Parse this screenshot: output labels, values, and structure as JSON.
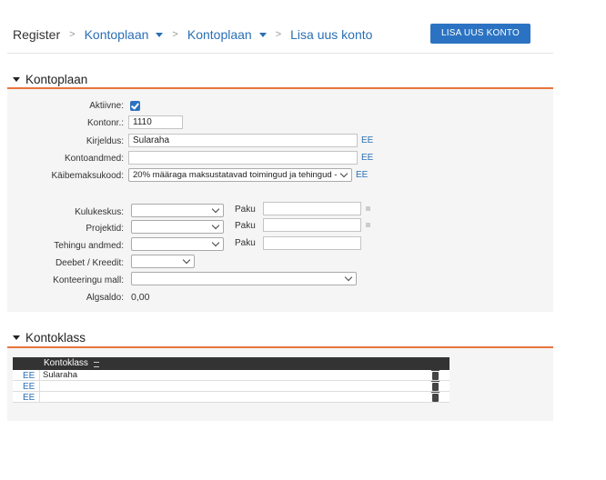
{
  "breadcrumb": {
    "root": "Register",
    "item1": "Kontoplaan",
    "item2": "Kontoplaan",
    "current": "Lisa uus konto"
  },
  "add_button": "LISA UUS KONTO",
  "section_kontoplaan": "Kontoplaan",
  "form": {
    "active_label": "Aktiivne:",
    "active_checked": true,
    "kontonr_label": "Kontonr.:",
    "kontonr_value": "1110",
    "kirjeldus_label": "Kirjeldus:",
    "kirjeldus_value": "Sularaha",
    "kontoandmed_label": "Kontoandmed:",
    "kontoandmed_value": "",
    "kaibemaks_label": "Käibemaksukood:",
    "kaibemaks_value": "20% määraga maksustatavad toimingud ja tehingud -",
    "ee_link": "EE",
    "kulukeskus_label": "Kulukeskus:",
    "projektid_label": "Projektid:",
    "tehingu_label": "Tehingu andmed:",
    "paku_label": "Paku",
    "deebet_label": "Deebet / Kreedit:",
    "konteering_label": "Konteeringu mall:",
    "algsaldo_label": "Algsaldo:",
    "algsaldo_value": "0,00"
  },
  "section_kontoklass": "Kontoklass",
  "kontoklass_table": {
    "header": "Kontoklass",
    "rows": [
      {
        "link": "EE",
        "value": "Sularaha"
      },
      {
        "link": "EE",
        "value": ""
      },
      {
        "link": "EE",
        "value": ""
      }
    ]
  },
  "icons": {
    "dropdown": "chevron-down-icon",
    "section_toggle": "triangle-down-icon",
    "delete": "trash-icon",
    "list": "list-icon",
    "checkbox": "check-icon"
  },
  "colors": {
    "accent": "#2b73c2",
    "section_rule": "#e9753d",
    "table_header": "#333333"
  }
}
